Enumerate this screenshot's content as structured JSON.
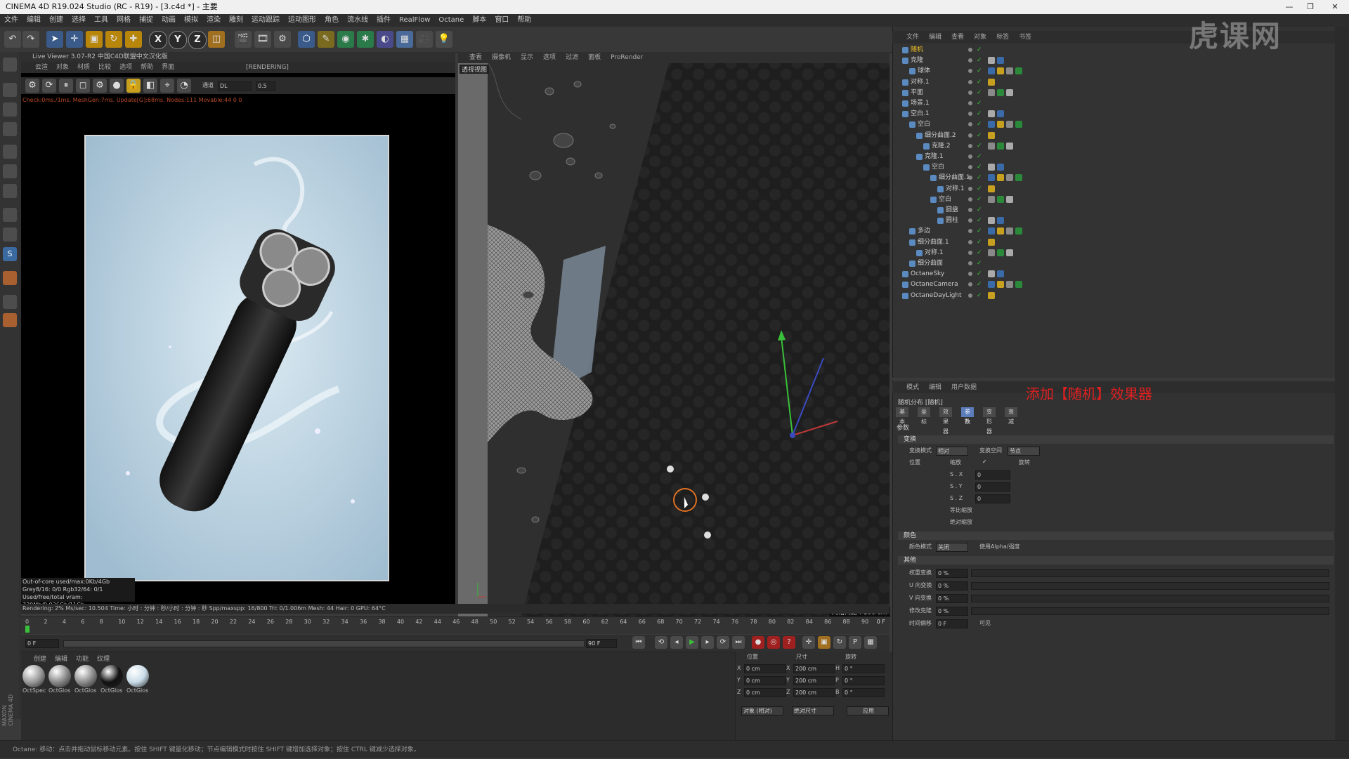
{
  "window": {
    "title": "CINEMA 4D R19.024 Studio (RC - R19) - [3.c4d *] - 主要"
  },
  "menu": [
    "文件",
    "编辑",
    "创建",
    "选择",
    "工具",
    "网格",
    "捕捉",
    "动画",
    "模拟",
    "渲染",
    "雕刻",
    "运动跟踪",
    "运动图形",
    "角色",
    "流水线",
    "插件",
    "RealFlow",
    "Octane",
    "脚本",
    "窗口",
    "帮助"
  ],
  "toolbar": {
    "axis_x": "X",
    "axis_y": "Y",
    "axis_z": "Z"
  },
  "live_viewer": {
    "header": "Live Viewer 3.07-R2 中国C4D联盟中文汉化版",
    "menu": [
      "云渲",
      "对象",
      "材质",
      "比较",
      "选项",
      "帮助",
      "界面"
    ],
    "rendering_label": "[RENDERING]",
    "channel_label": "通道",
    "channel_value": "DL",
    "channel_num": "0.5",
    "status": "Check:0ms./1ms. MeshGen:7ms. Update[G]:68ms. Nodes:111 Movable:44  0 0",
    "info_lines": [
      "Out-of-core used/max:0Kb/4Gb",
      "Grey8/16: 0/0       Rgb32/64: 0/1",
      "Used/free/total vram: 730Mb/9.936Gb/11Gb"
    ]
  },
  "render_stats": "Rendering: 2%  Ms/sec: 10.504  Time: 小时 : 分钟 : 秒/小时 : 分钟 : 秒  Spp/maxspp: 16/800  Tri: 0/1.006m  Mesh: 44  Hair: 0  GPU: 64°C",
  "viewport": {
    "menu": [
      "查看",
      "摄像机",
      "显示",
      "选项",
      "过滤",
      "面板",
      "ProRender"
    ],
    "label": "透视视图",
    "grid_caption": "网格间距 : 100 cm"
  },
  "timeline": {
    "ticks": [
      "0",
      "2",
      "4",
      "6",
      "8",
      "10",
      "12",
      "14",
      "16",
      "18",
      "20",
      "22",
      "24",
      "26",
      "28",
      "30",
      "32",
      "34",
      "36",
      "38",
      "40",
      "42",
      "44",
      "46",
      "48",
      "50",
      "52",
      "54",
      "56",
      "58",
      "60",
      "62",
      "64",
      "66",
      "68",
      "70",
      "72",
      "74",
      "76",
      "78",
      "80",
      "82",
      "84",
      "86",
      "88",
      "90"
    ],
    "current": "0 F",
    "start": "0 F",
    "end": "90 F",
    "range_start": "0 F",
    "range_end": "90 F"
  },
  "materials": {
    "menu": [
      "创建",
      "编辑",
      "功能",
      "纹理"
    ],
    "items": [
      "OctSpec",
      "OctGlos",
      "OctGlos",
      "OctGlos",
      "OctGlos"
    ]
  },
  "coords": {
    "headers": [
      "位置",
      "尺寸",
      "旋转"
    ],
    "rows": [
      {
        "axis": "X",
        "pos": "0 cm",
        "size_axis": "X",
        "size": "200 cm",
        "rot_axis": "H",
        "rot": "0 °"
      },
      {
        "axis": "Y",
        "pos": "0 cm",
        "size_axis": "Y",
        "size": "200 cm",
        "rot_axis": "P",
        "rot": "0 °"
      },
      {
        "axis": "Z",
        "pos": "0 cm",
        "size_axis": "Z",
        "size": "200 cm",
        "rot_axis": "B",
        "rot": "0 °"
      }
    ],
    "mode1": "对象 (相对)",
    "mode2": "绝对尺寸",
    "apply": "应用"
  },
  "objects": {
    "menu": [
      "文件",
      "编辑",
      "查看",
      "对象",
      "标签",
      "书签"
    ],
    "rows": [
      {
        "name": "随机",
        "indent": 0,
        "highlight": true
      },
      {
        "name": "克隆",
        "indent": 0
      },
      {
        "name": "球体",
        "indent": 1
      },
      {
        "name": "对称.1",
        "indent": 0
      },
      {
        "name": "平面",
        "indent": 0
      },
      {
        "name": "场景.1",
        "indent": 0
      },
      {
        "name": "空白.1",
        "indent": 0
      },
      {
        "name": "空白",
        "indent": 1
      },
      {
        "name": "细分曲面.2",
        "indent": 2
      },
      {
        "name": "克隆.2",
        "indent": 3
      },
      {
        "name": "克隆.1",
        "indent": 2
      },
      {
        "name": "空白",
        "indent": 3
      },
      {
        "name": "细分曲面.1",
        "indent": 4
      },
      {
        "name": "对称.1",
        "indent": 5
      },
      {
        "name": "空白",
        "indent": 4
      },
      {
        "name": "圆盘",
        "indent": 5
      },
      {
        "name": "圆柱",
        "indent": 5
      },
      {
        "name": "多边",
        "indent": 1
      },
      {
        "name": "细分曲面.1",
        "indent": 1
      },
      {
        "name": "对称.1",
        "indent": 2
      },
      {
        "name": "细分曲面",
        "indent": 1
      },
      {
        "name": "OctaneSky",
        "indent": 0
      },
      {
        "name": "OctaneCamera",
        "indent": 0
      },
      {
        "name": "OctaneDayLight",
        "indent": 0
      }
    ]
  },
  "attributes": {
    "menu": [
      "模式",
      "编辑",
      "用户数据"
    ],
    "annotation": "添加【随机】效果器",
    "object_title": "随机分布 [随机]",
    "tabs": [
      "基本",
      "坐标",
      "效果器",
      "参数",
      "变形器",
      "衰减"
    ],
    "section_params": "参数",
    "section_transform": "变换",
    "transform_mode_label": "变换模式",
    "transform_mode_value": "相对",
    "transform_space_label": "变换空间",
    "transform_space_value": "节点",
    "position_label": "位置",
    "scale_label": "缩放",
    "rotate_label": "旋转",
    "sx_label": "S . X",
    "sx_value": "0",
    "sy_label": "S . Y",
    "sy_value": "0",
    "sz_label": "S . Z",
    "sz_value": "0",
    "equal_scale": "等比缩放",
    "absolute_scale": "绝对缩放",
    "section_color": "颜色",
    "color_mode_label": "颜色模式",
    "color_mode_value": "关闭",
    "use_alpha": "使用Alpha/强度",
    "section_other": "其他",
    "weight_label": "权重变换",
    "weight_value": "0 %",
    "u_label": "U 向变换",
    "u_value": "0 %",
    "v_label": "V 向变换",
    "v_value": "0 %",
    "mod_label": "修改克隆",
    "mod_value": "0 %",
    "time_label": "时间偏移",
    "time_value": "0 F",
    "visible_label": "可见"
  },
  "statusbar": "Octane:   移动：点击并拖动鼠标移动元素。按住 SHIFT 键量化移动；节点编辑模式时按住 SHIFT 键增加选择对象；按住 CTRL 键减少选择对象。",
  "watermark": "虎课网",
  "maxon_logo": "MAXON CINEMA 4D",
  "colors": {
    "accent": "#5b7dbb",
    "annotation": "#e02020",
    "cursor_ring": "#e07020"
  }
}
